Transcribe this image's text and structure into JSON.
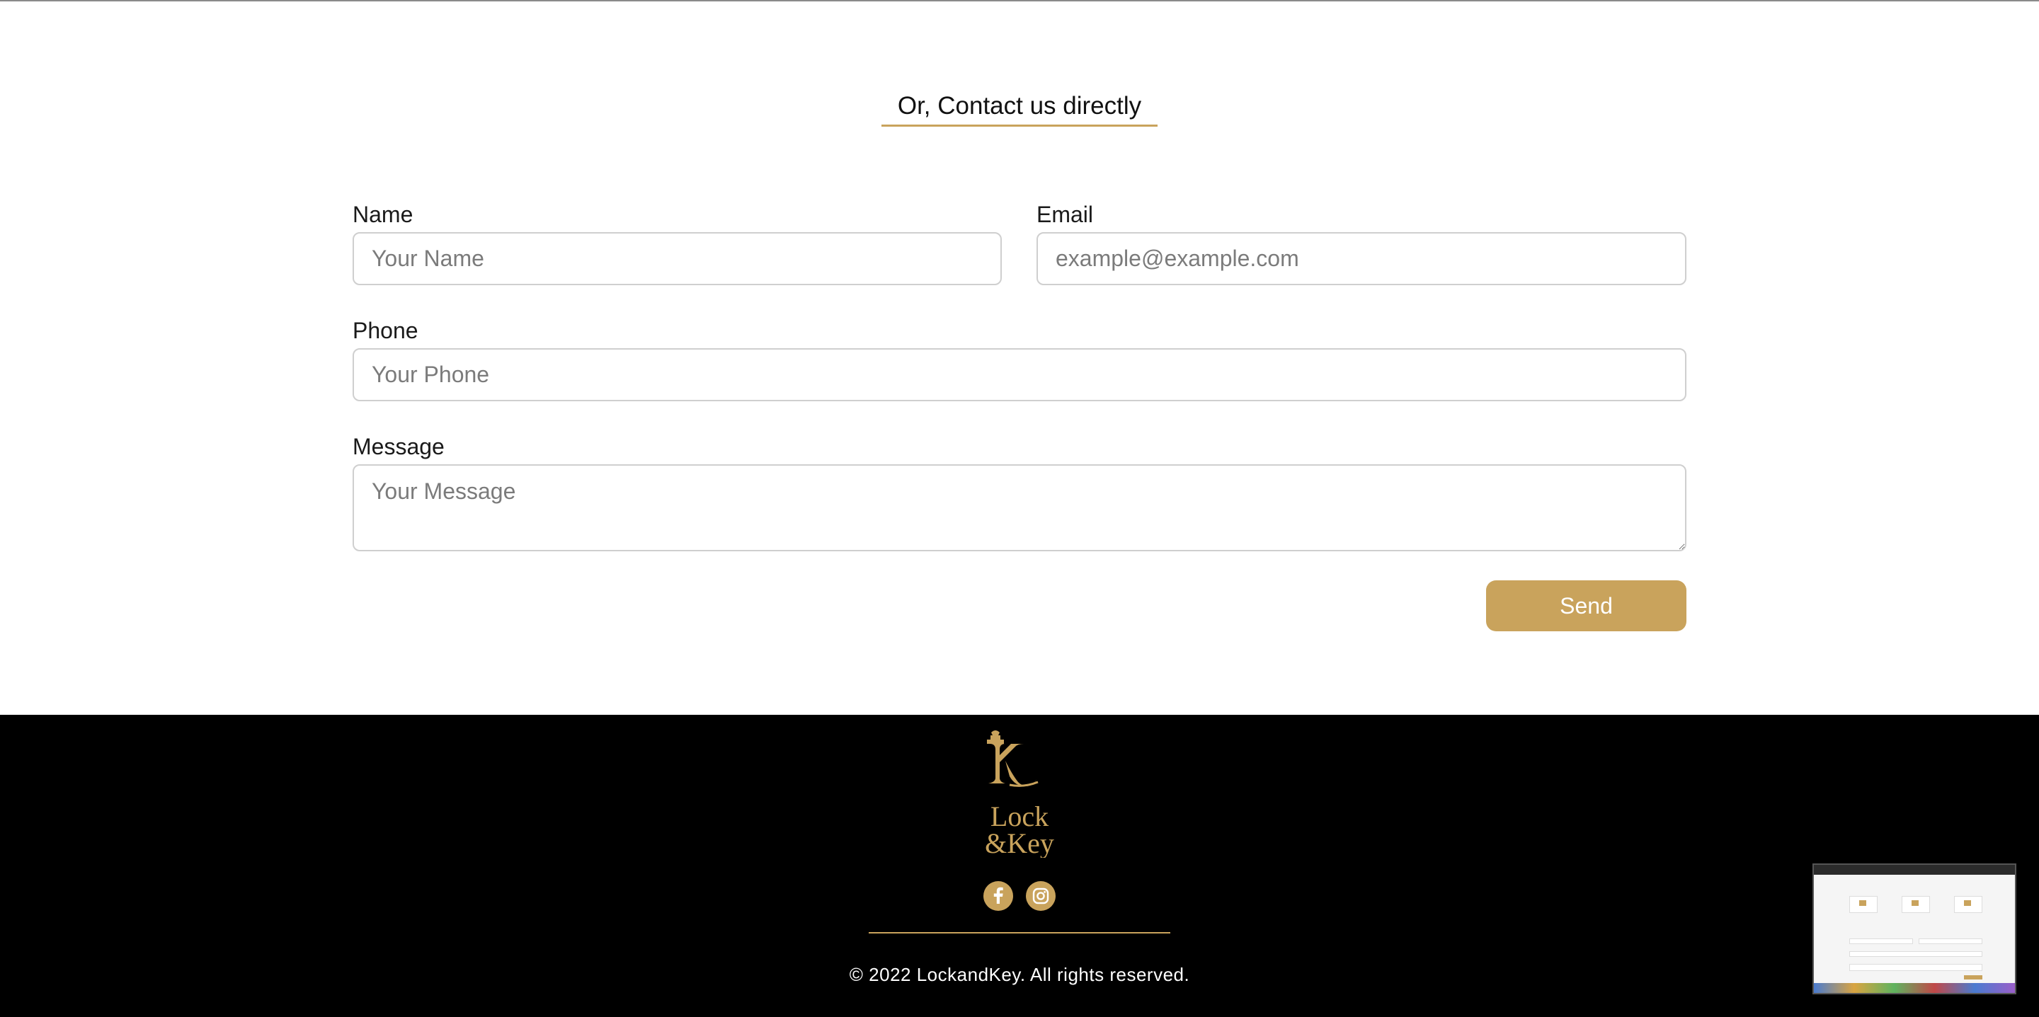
{
  "contact": {
    "heading": "Or, Contact us directly",
    "name_label": "Name",
    "name_placeholder": "Your Name",
    "email_label": "Email",
    "email_placeholder": "example@example.com",
    "phone_label": "Phone",
    "phone_placeholder": "Your Phone",
    "message_label": "Message",
    "message_placeholder": "Your Message",
    "send_label": "Send"
  },
  "footer": {
    "logo_text": [
      "Lock",
      "&Key"
    ],
    "social": [
      "facebook-icon",
      "instagram-icon"
    ],
    "copyright": "© 2022 LockandKey. All rights reserved."
  },
  "colors": {
    "accent": "#c9a35c",
    "footer_bg": "#000000"
  }
}
